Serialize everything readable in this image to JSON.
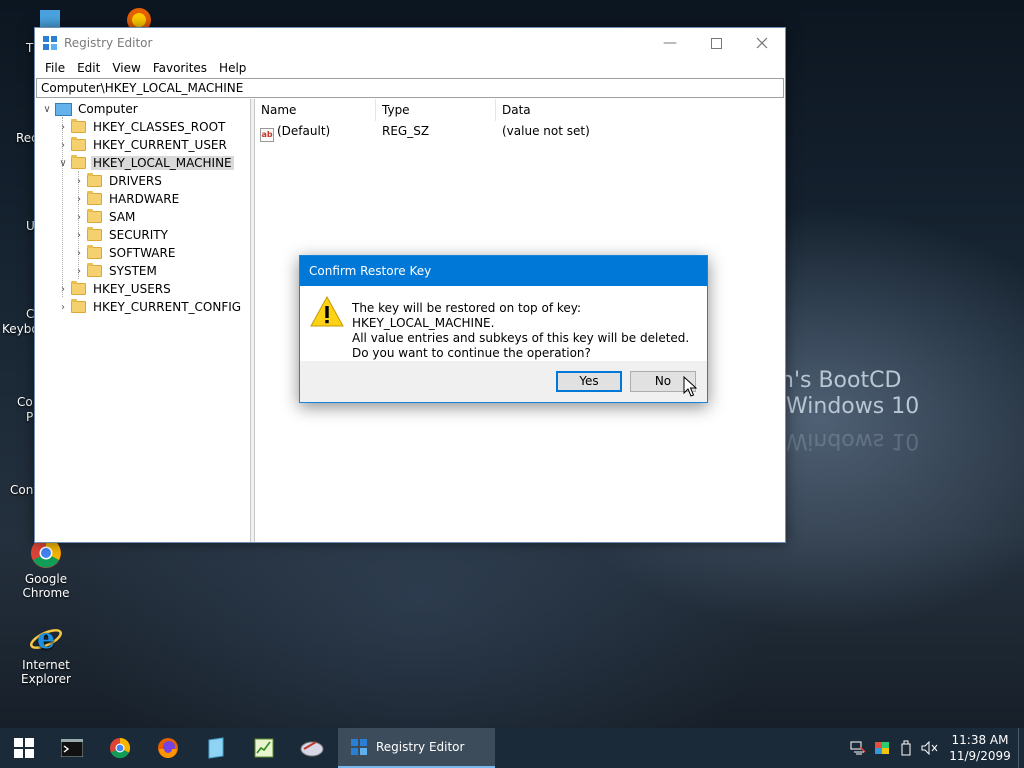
{
  "desktop": {
    "fragments": [
      "T",
      "Rec",
      "U",
      "C",
      "Keybo",
      "Co",
      "P",
      "Cont"
    ],
    "icons": [
      {
        "label": "Google Chrome",
        "icon": "chrome-icon"
      },
      {
        "label": "Internet Explorer",
        "icon": "internet-explorer-icon"
      }
    ],
    "wallpaper_line1": "n's BootCD",
    "wallpaper_line2": "Windows 10",
    "wallpaper_mirror": "Windows 10"
  },
  "window": {
    "title": "Registry Editor",
    "menu": [
      "File",
      "Edit",
      "View",
      "Favorites",
      "Help"
    ],
    "address": "Computer\\HKEY_LOCAL_MACHINE",
    "tree": {
      "root": "Computer",
      "hives": [
        "HKEY_CLASSES_ROOT",
        "HKEY_CURRENT_USER",
        "HKEY_LOCAL_MACHINE",
        "HKEY_USERS",
        "HKEY_CURRENT_CONFIG"
      ],
      "selected": "HKEY_LOCAL_MACHINE",
      "hklm_children": [
        "DRIVERS",
        "HARDWARE",
        "SAM",
        "SECURITY",
        "SOFTWARE",
        "SYSTEM"
      ]
    },
    "columns": [
      "Name",
      "Type",
      "Data"
    ],
    "values": [
      {
        "name": "(Default)",
        "type": "REG_SZ",
        "data": "(value not set)"
      }
    ]
  },
  "dialog": {
    "title": "Confirm Restore Key",
    "line1": "The key will be restored on top of key: HKEY_LOCAL_MACHINE.",
    "line2": "All value entries and subkeys of this key will be deleted.",
    "line3": "Do you want to continue the operation?",
    "yes": "Yes",
    "no": "No"
  },
  "taskbar": {
    "active_task": "Registry Editor",
    "time": "11:38 AM",
    "date": "11/9/2099"
  },
  "colors": {
    "accent": "#0078d7",
    "taskbar": "#1b2a38"
  }
}
